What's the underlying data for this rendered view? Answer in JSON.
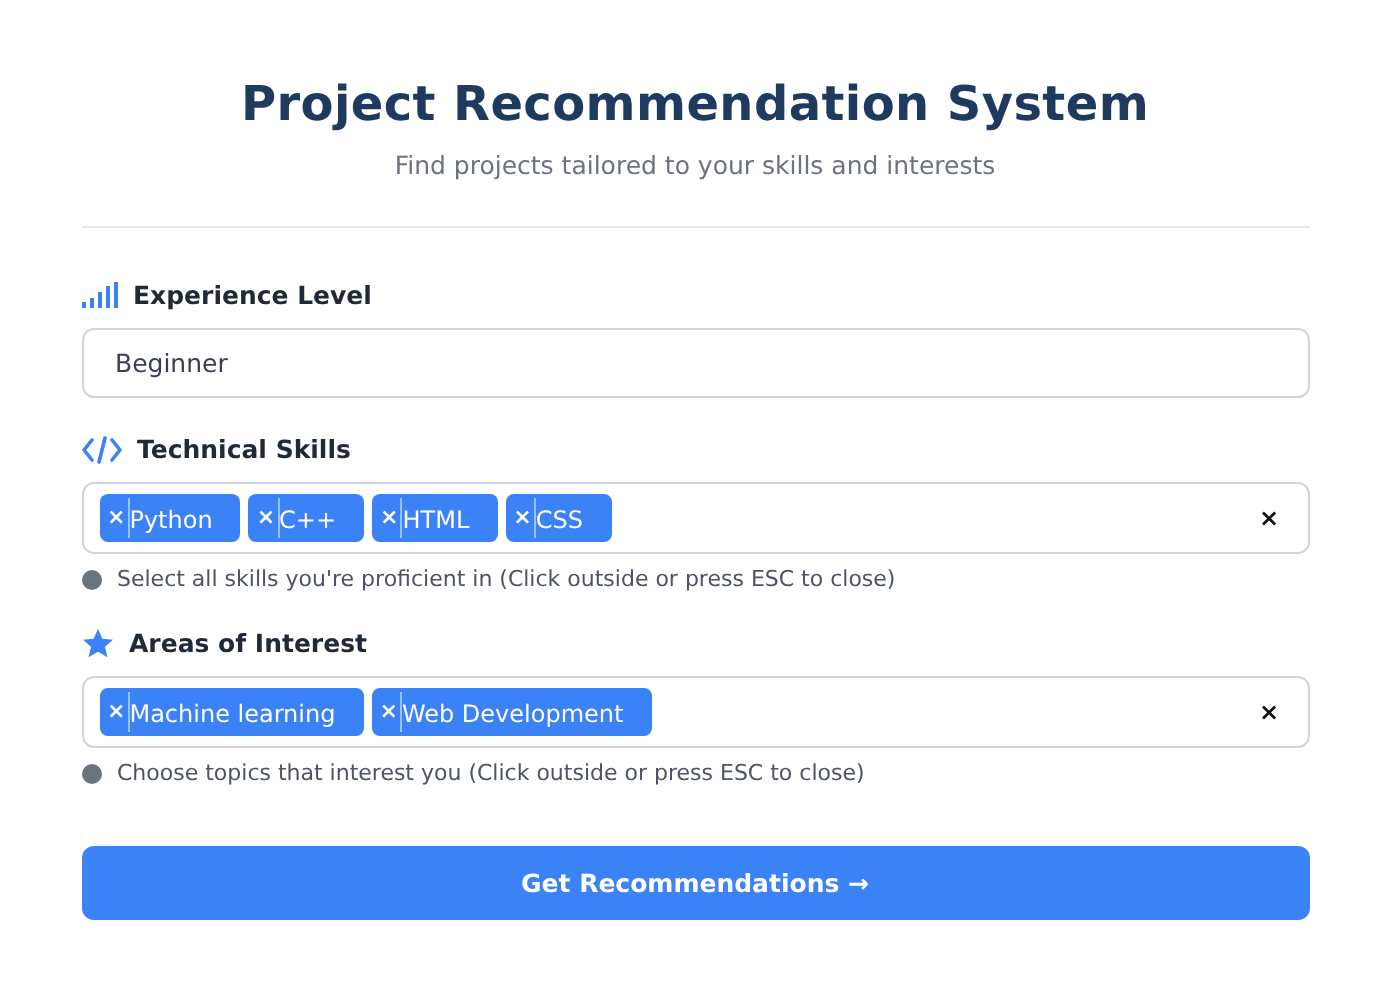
{
  "header": {
    "title": "Project Recommendation System",
    "subtitle": "Find projects tailored to your skills and interests"
  },
  "fields": [
    {
      "kind": "select",
      "label": "Experience Level",
      "value": "Beginner"
    },
    {
      "kind": "tags",
      "label": "Technical Skills",
      "tags": [
        {
          "remove": "×",
          "label": "Python"
        },
        {
          "remove": "×",
          "label": "C++"
        },
        {
          "remove": "×",
          "label": "HTML"
        },
        {
          "remove": "×",
          "label": "CSS"
        }
      ],
      "clear": "×",
      "hint": "Select all skills you're proficient in (Click outside or press ESC to close)"
    },
    {
      "kind": "tags",
      "label": "Areas of Interest",
      "tags": [
        {
          "remove": "×",
          "label": "Machine learning"
        },
        {
          "remove": "×",
          "label": "Web Development"
        }
      ],
      "clear": "×",
      "hint": "Choose topics that interest you (Click outside or press ESC to close)"
    }
  ],
  "submit": {
    "label": "Get Recommendations",
    "arrow": "→"
  }
}
